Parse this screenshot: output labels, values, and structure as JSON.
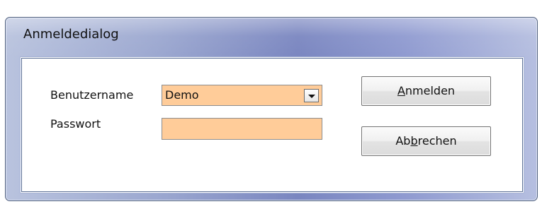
{
  "window": {
    "title": "Anmeldedialog"
  },
  "form": {
    "username_label": "Benutzername",
    "username_value": "Demo",
    "password_label": "Passwort",
    "password_value": ""
  },
  "buttons": {
    "login": {
      "accesskey": "A",
      "rest": "nmelden"
    },
    "cancel": {
      "pre": "Ab",
      "accesskey": "b",
      "rest": "rechen"
    }
  },
  "colors": {
    "field_background": "#ffcc99",
    "title_gradient_mid": "#7a86c0"
  },
  "icons": {
    "dropdown": "chevron-down-icon"
  }
}
